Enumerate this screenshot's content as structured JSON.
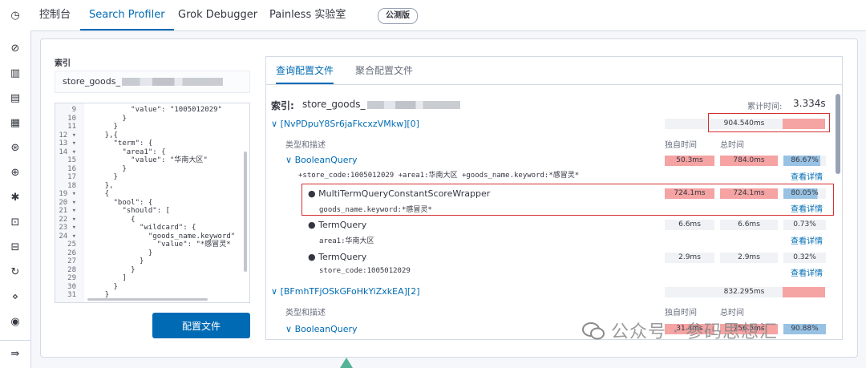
{
  "nav": {
    "tabs": [
      "控制台",
      "Search Profiler",
      "Grok Debugger",
      "Painless 实验室"
    ],
    "beta_badge": "公测版"
  },
  "sidebar": {
    "icons": [
      "clock-icon",
      "compass-icon",
      "chart-icon",
      "dashboard-icon",
      "canvas-icon",
      "map-icon",
      "ml-icon",
      "graph-icon",
      "monitor-icon",
      "logs-icon",
      "uptime-icon",
      "apm-icon",
      "signal-icon",
      "dev-tools-icon",
      "collapse-icon"
    ]
  },
  "left": {
    "index_label": "索引",
    "index_value": "store_goods_",
    "button_label": "配置文件",
    "code_lines": [
      {
        "n": "9",
        "fold": false,
        "text": "          \"value\": \"1005012029\""
      },
      {
        "n": "10",
        "fold": false,
        "text": "        }"
      },
      {
        "n": "11",
        "fold": false,
        "text": "      }"
      },
      {
        "n": "12",
        "fold": true,
        "text": "    },{"
      },
      {
        "n": "13",
        "fold": true,
        "text": "      \"term\": {"
      },
      {
        "n": "14",
        "fold": true,
        "text": "        \"area1\": {"
      },
      {
        "n": "15",
        "fold": false,
        "text": "          \"value\": \"华南大区\""
      },
      {
        "n": "16",
        "fold": false,
        "text": "        }"
      },
      {
        "n": "17",
        "fold": false,
        "text": "      }"
      },
      {
        "n": "18",
        "fold": false,
        "text": "    },"
      },
      {
        "n": "19",
        "fold": true,
        "text": "    {"
      },
      {
        "n": "20",
        "fold": true,
        "text": "      \"bool\": {"
      },
      {
        "n": "21",
        "fold": true,
        "text": "        \"should\": ["
      },
      {
        "n": "22",
        "fold": true,
        "text": "          {"
      },
      {
        "n": "23",
        "fold": true,
        "text": "            \"wildcard\": {"
      },
      {
        "n": "24",
        "fold": true,
        "text": "              \"goods_name.keyword\""
      },
      {
        "n": "25",
        "fold": false,
        "text": "                \"value\": \"*感冒灵*"
      },
      {
        "n": "26",
        "fold": false,
        "text": "              }"
      },
      {
        "n": "27",
        "fold": false,
        "text": "            }"
      },
      {
        "n": "28",
        "fold": false,
        "text": "          }"
      },
      {
        "n": "29",
        "fold": false,
        "text": "        ]"
      },
      {
        "n": "30",
        "fold": false,
        "text": "      }"
      },
      {
        "n": "31",
        "fold": false,
        "text": "    }"
      }
    ]
  },
  "right": {
    "tabs": [
      "查询配置文件",
      "聚合配置文件"
    ],
    "index_label": "索引:",
    "index_value": "store_goods_",
    "total_time_label": "累计时间:",
    "total_time": "3.334s",
    "shard1": {
      "name": "[NvPDpuY8Sr6jaFkcxzVMkw][0]",
      "time": "904.540ms"
    },
    "shard2": {
      "name": "[BFmhTFjOSkGFoHkYiZxkEA][2]",
      "time": "832.295ms"
    },
    "col_type": "类型和描述",
    "col_self": "独自时间",
    "col_total": "总时间",
    "details_link": "查看详情",
    "rows": [
      {
        "name": "BooleanQuery",
        "desc": "+store_code:1005012029 +area1:华南大区 +goods_name.keyword:*感冒灵*",
        "self": "50.3ms",
        "total": "784.0ms",
        "pct": "86.67%",
        "pct_value": 86.67
      },
      {
        "name": "MultiTermQueryConstantScoreWrapper",
        "desc": "goods_name.keyword:*感冒灵*",
        "self": "724.1ms",
        "total": "724.1ms",
        "pct": "80.05%",
        "pct_value": 80.05
      },
      {
        "name": "TermQuery",
        "desc": "area1:华南大区",
        "self": "6.6ms",
        "total": "6.6ms",
        "pct": "0.73%",
        "pct_value": 0.73
      },
      {
        "name": "TermQuery",
        "desc": "store_code:1005012029",
        "self": "2.9ms",
        "total": "2.9ms",
        "pct": "0.32%",
        "pct_value": 0.32
      }
    ],
    "shard2_rows": [
      {
        "name": "BooleanQuery",
        "self": "31.4ms",
        "total": "756.5ms",
        "pct": "90.88%"
      }
    ]
  },
  "watermark": "公众号 · 参码思想汇",
  "colors": {
    "accent": "#006bb4",
    "highlight": "#f5a3a3",
    "pct_bar": "#98c2e3",
    "annotation": "#d63030"
  }
}
